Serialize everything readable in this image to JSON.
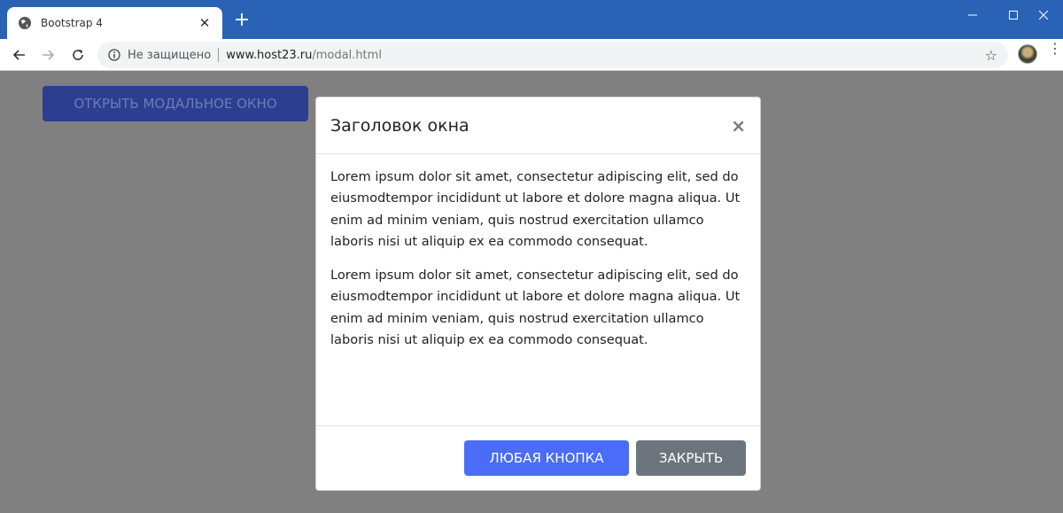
{
  "browser": {
    "tab": {
      "title": "Bootstrap 4",
      "close_glyph": "✕"
    },
    "new_tab_glyph": "+",
    "window_controls": {
      "minimize": "—",
      "maximize": "☐",
      "close": "✕"
    },
    "address": {
      "security_label": "Не защищено",
      "host": "www.host23.ru",
      "path": "/modal.html"
    },
    "star_glyph": "☆",
    "kebab_glyph": "⋮"
  },
  "page": {
    "open_button_label": "ОТКРЫТЬ МОДАЛЬНОЕ ОКНО"
  },
  "modal": {
    "title": "Заголовок окна",
    "close_glyph": "×",
    "paragraphs": [
      "Lorem ipsum dolor sit amet, consectetur adipiscing elit, sed do eiusmodtempor incididunt ut labore et dolore magna aliqua. Ut enim ad minim veniam, quis nostrud exercitation ullamco laboris nisi ut aliquip ex ea commodo consequat.",
      "Lorem ipsum dolor sit amet, consectetur adipiscing elit, sed do eiusmodtempor incididunt ut labore et dolore magna aliqua. Ut enim ad minim veniam, quis nostrud exercitation ullamco laboris nisi ut aliquip ex ea commodo consequat."
    ],
    "primary_button": "ЛЮБАЯ КНОПКА",
    "secondary_button": "ЗАКРЫТЬ"
  },
  "colors": {
    "titlebar": "#2a62b5",
    "backdrop": "#808080",
    "primary": "#4a6cf7",
    "secondary": "#6c757d"
  }
}
